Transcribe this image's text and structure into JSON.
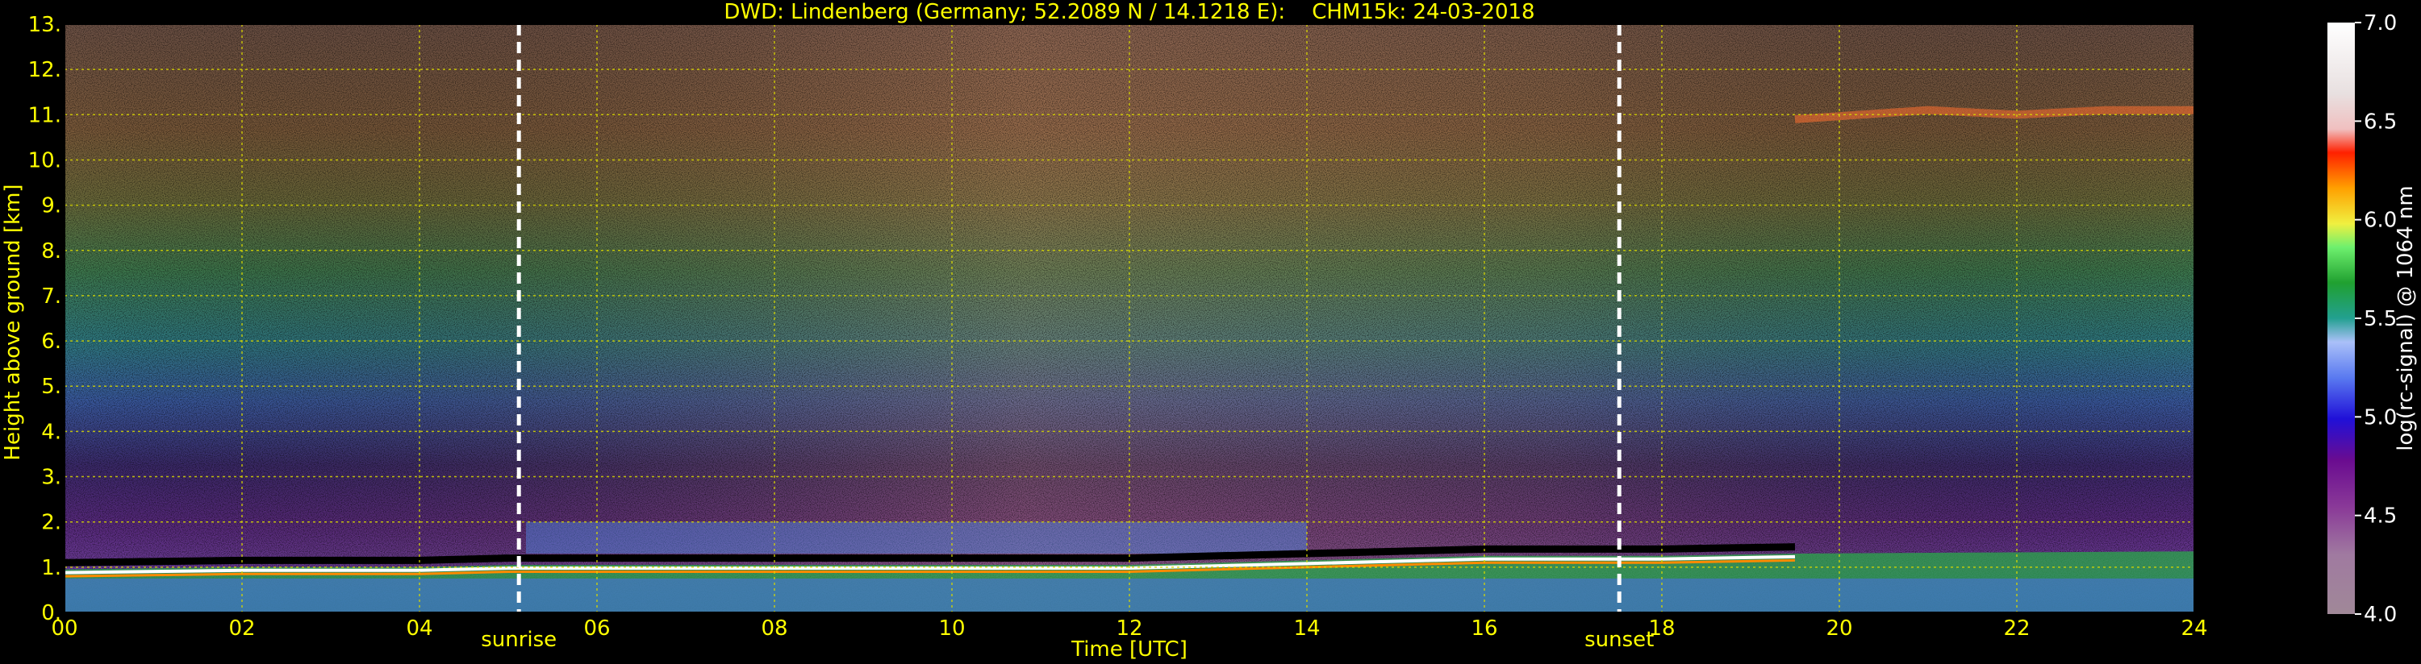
{
  "chart_data": {
    "type": "heatmap",
    "title": "DWD: Lindenberg (Germany; 52.2089 N / 14.1218 E):    CHM15k: 24-03-2018",
    "xlabel": "Time [UTC]",
    "ylabel": "Height above ground [km]",
    "xlim": [
      0,
      24
    ],
    "ylim": [
      0,
      13
    ],
    "x_ticks": [
      "00",
      "02",
      "04",
      "06",
      "08",
      "10",
      "12",
      "14",
      "16",
      "18",
      "20",
      "22",
      "24"
    ],
    "y_ticks": [
      "0.",
      "1.",
      "2.",
      "3.",
      "4.",
      "5.",
      "6.",
      "7.",
      "8.",
      "9.",
      "10.",
      "11.",
      "12.",
      "13."
    ],
    "grid": true,
    "colorbar": {
      "label": "log(rc-signal) @ 1064 nm",
      "range": [
        4.0,
        7.0
      ],
      "ticks": [
        "4.0",
        "4.5",
        "5.0",
        "5.5",
        "6.0",
        "6.5",
        "7.0"
      ]
    },
    "events": [
      {
        "label": "sunrise",
        "time": 5.12
      },
      {
        "label": "sunset",
        "time": 17.52
      }
    ],
    "boundary_layer_top_km": [
      [
        0,
        1.1
      ],
      [
        2,
        1.15
      ],
      [
        4,
        1.15
      ],
      [
        5,
        1.2
      ],
      [
        6,
        1.2
      ],
      [
        8,
        1.2
      ],
      [
        10,
        1.2
      ],
      [
        12,
        1.2
      ],
      [
        14,
        1.3
      ],
      [
        16,
        1.4
      ],
      [
        18,
        1.4
      ],
      [
        19.5,
        1.45
      ]
    ],
    "cirrus_layer_km": [
      [
        19.5,
        10.9
      ],
      [
        21,
        11.1
      ],
      [
        22,
        11.0
      ],
      [
        23,
        11.1
      ],
      [
        24,
        11.1
      ]
    ]
  },
  "colors": {
    "axis_text": "#ffff00",
    "grid": "#d8d800",
    "event_line": "#ffffff"
  }
}
